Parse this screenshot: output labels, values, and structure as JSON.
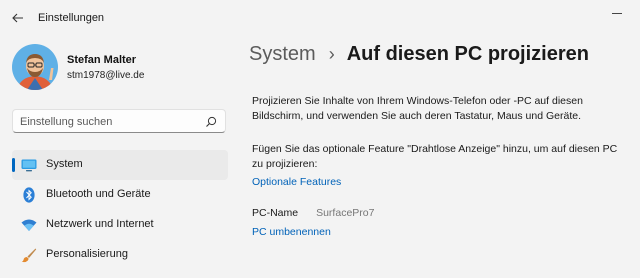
{
  "window": {
    "app_title": "Einstellungen"
  },
  "profile": {
    "name": "Stefan Malter",
    "email": "stm1978@live.de"
  },
  "search": {
    "placeholder": "Einstellung suchen"
  },
  "sidebar": {
    "items": [
      {
        "label": "System",
        "icon": "monitor-icon",
        "active": true
      },
      {
        "label": "Bluetooth und Geräte",
        "icon": "bluetooth-icon",
        "active": false
      },
      {
        "label": "Netzwerk und Internet",
        "icon": "wifi-icon",
        "active": false
      },
      {
        "label": "Personalisierung",
        "icon": "brush-icon",
        "active": false
      }
    ]
  },
  "breadcrumb": {
    "parent": "System",
    "separator": "›",
    "current": "Auf diesen PC projizieren"
  },
  "main": {
    "description": "Projizieren Sie Inhalte von Ihrem Windows-Telefon oder -PC auf diesen Bildschirm, und verwenden Sie auch deren Tastatur, Maus und Geräte.",
    "feature_hint": "Fügen Sie das optionale Feature \"Drahtlose Anzeige\" hinzu, um auf diesen PC zu projizieren:",
    "optional_features_link": "Optionale Features",
    "pc_name_label": "PC-Name",
    "pc_name_value": "SurfacePro7",
    "rename_link": "PC umbenennen"
  },
  "colors": {
    "accent": "#0067c0",
    "link": "#0062b8",
    "background": "#f3f3f3"
  }
}
